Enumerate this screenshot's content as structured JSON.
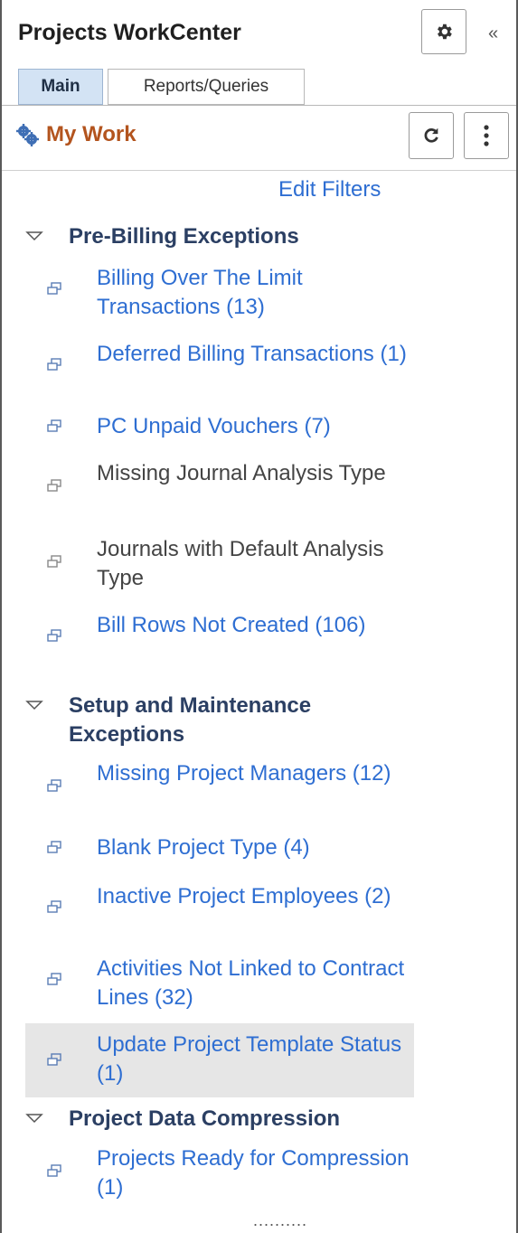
{
  "header": {
    "title": "Projects WorkCenter",
    "collapse_label": "«"
  },
  "tabs": [
    {
      "label": "Main",
      "active": true
    },
    {
      "label": "Reports/Queries",
      "active": false
    }
  ],
  "pagelet": {
    "title": "My Work",
    "edit_filters": "Edit Filters"
  },
  "sections": [
    {
      "title": "Pre-Billing Exceptions",
      "items": [
        {
          "label": "Billing Over The Limit Transactions (13)",
          "link": true
        },
        {
          "label": "Deferred Billing Transactions (1)",
          "link": true
        },
        {
          "label": "PC Unpaid Vouchers (7)",
          "link": true
        },
        {
          "label": "Missing Journal Analysis Type",
          "link": false
        },
        {
          "label": "Journals with Default Analysis Type",
          "link": false
        },
        {
          "label": "Bill Rows Not Created (106)",
          "link": true
        }
      ]
    },
    {
      "title": "Setup and Maintenance Exceptions",
      "items": [
        {
          "label": "Missing Project Managers (12)",
          "link": true
        },
        {
          "label": "Blank Project Type (4)",
          "link": true
        },
        {
          "label": "Inactive Project Employees (2)",
          "link": true
        },
        {
          "label": "Activities Not Linked to Contract Lines (32)",
          "link": true
        },
        {
          "label": "Update Project Template Status (1)",
          "link": true,
          "highlighted": true
        }
      ]
    },
    {
      "title": "Project Data Compression",
      "items": [
        {
          "label": "Projects Ready for Compression (1)",
          "link": true
        }
      ]
    }
  ],
  "footer": {
    "more_dots": ".........."
  },
  "colors": {
    "link": "#2e6ed2",
    "section_title": "#2b3f63",
    "pagelet_title": "#b3541e",
    "active_tab": "#d3e3f4",
    "highlight": "#e6e6e6"
  }
}
